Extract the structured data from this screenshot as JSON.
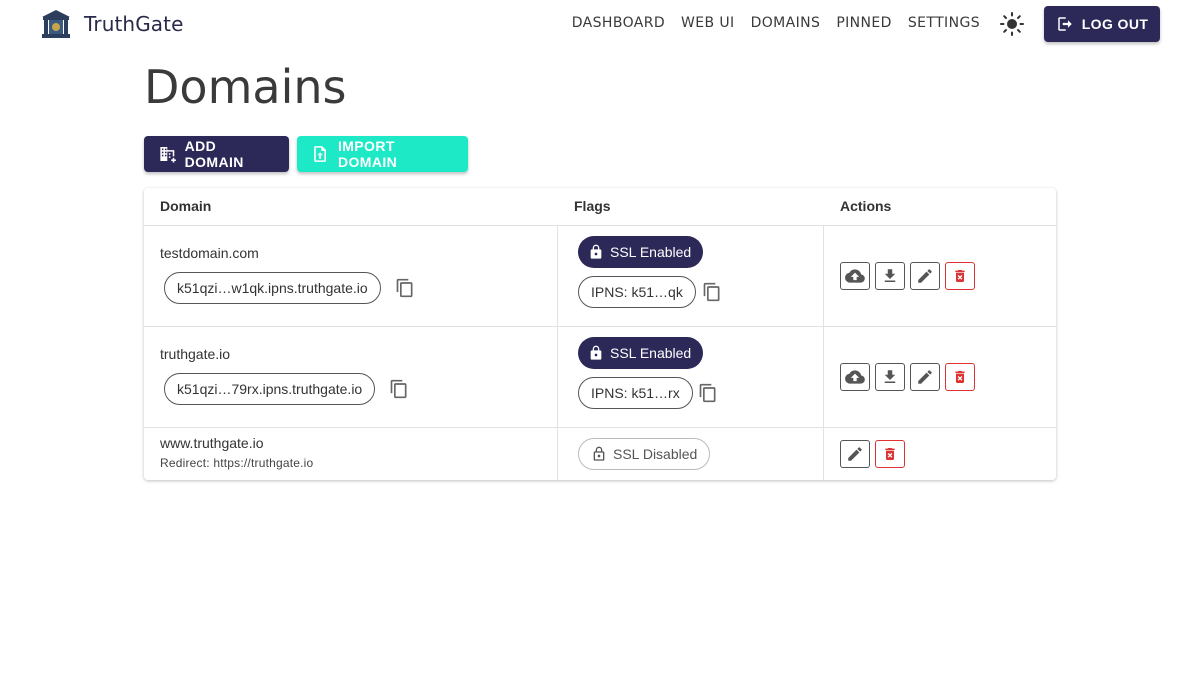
{
  "app": {
    "name": "TruthGate"
  },
  "nav": [
    "DASHBOARD",
    "WEB UI",
    "DOMAINS",
    "PINNED",
    "SETTINGS"
  ],
  "header": {
    "logout_label": "LOG OUT"
  },
  "page": {
    "title": "Domains"
  },
  "actions": {
    "add_label": "ADD DOMAIN",
    "import_label": "IMPORT DOMAIN"
  },
  "table": {
    "headers": [
      "Domain",
      "Flags",
      "Actions"
    ],
    "rows": [
      {
        "domain": "testdomain.com",
        "gateway": "k51qzi…w1qk.ipns.truthgate.io",
        "ssl": "SSL Enabled",
        "ipns": "IPNS: k51…qk"
      },
      {
        "domain": "truthgate.io",
        "gateway": "k51qzi…79rx.ipns.truthgate.io",
        "ssl": "SSL Enabled",
        "ipns": "IPNS: k51…rx"
      },
      {
        "domain": "www.truthgate.io",
        "redirect": "Redirect: https://truthgate.io",
        "ssl": "SSL Disabled"
      }
    ]
  },
  "colors": {
    "primary": "#2c2858",
    "accent": "#1de9c7",
    "danger": "#d33333"
  },
  "icons": [
    "building-icon",
    "theme-sun-icon",
    "logout-icon",
    "add-building-icon",
    "upload-file-icon",
    "copy-icon",
    "lock-icon",
    "lock-open-icon",
    "cloud-upload-icon",
    "download-icon",
    "edit-icon",
    "delete-icon"
  ]
}
